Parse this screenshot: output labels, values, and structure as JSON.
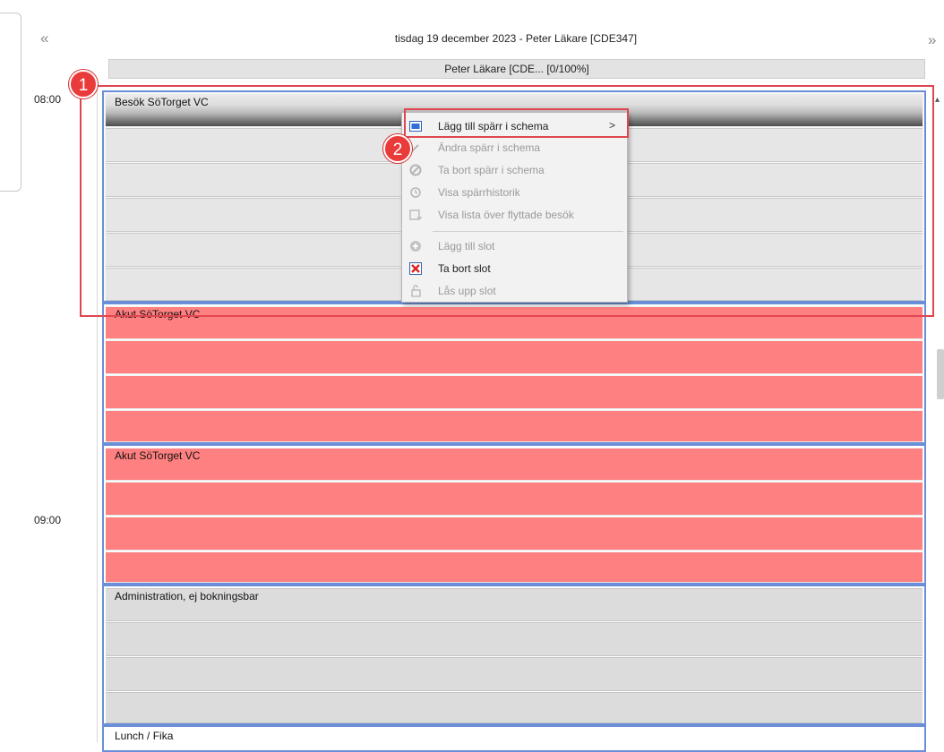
{
  "nav": {
    "prev_icon": "double-chevron-left",
    "next_icon": "double-chevron-right",
    "prev_glyph": "«",
    "next_glyph": "»"
  },
  "header": {
    "date_title": "tisdag 19 december 2023 - Peter Läkare [CDE347]",
    "column_title": "Peter Läkare [CDE... [0/100%]"
  },
  "time_labels": [
    "08:00",
    "09:00"
  ],
  "schedule_blocks": [
    {
      "title": "Besök SöTorget VC",
      "style": "selected",
      "color": "#e6e6e6"
    },
    {
      "title": "Akut SöTorget VC",
      "style": "red",
      "color": "#ff8080"
    },
    {
      "title": "Akut SöTorget VC",
      "style": "red",
      "color": "#ff8080"
    },
    {
      "title": "Administration, ej bokningsbar",
      "style": "gray",
      "color": "#dcdcdc"
    },
    {
      "title": "Lunch / Fika",
      "style": "white",
      "color": "#ffffff"
    }
  ],
  "context_menu": {
    "items": [
      {
        "label": "Lägg till spärr i schema",
        "icon": "calendar-block-icon",
        "enabled": true,
        "submenu": true
      },
      {
        "label": "Ändra spärr i schema",
        "icon": "edit-block-icon",
        "enabled": false
      },
      {
        "label": "Ta bort spärr i schema",
        "icon": "remove-block-icon",
        "enabled": false
      },
      {
        "label": "Visa spärrhistorik",
        "icon": "history-icon",
        "enabled": false
      },
      {
        "label": "Visa lista över flyttade besök",
        "icon": "moved-visits-list-icon",
        "enabled": false
      },
      {
        "label": "Lägg till slot",
        "icon": "add-slot-icon",
        "enabled": false
      },
      {
        "label": "Ta bort slot",
        "icon": "delete-slot-icon",
        "enabled": true
      },
      {
        "label": "Lås upp slot",
        "icon": "unlock-slot-icon",
        "enabled": false
      }
    ],
    "submenu_arrow": ">"
  },
  "annotations": {
    "badge_1": "1",
    "badge_2": "2"
  },
  "colors": {
    "block_border": "#6a8fd8",
    "highlight": "#e0464f",
    "badge": "#ea3b3b"
  }
}
